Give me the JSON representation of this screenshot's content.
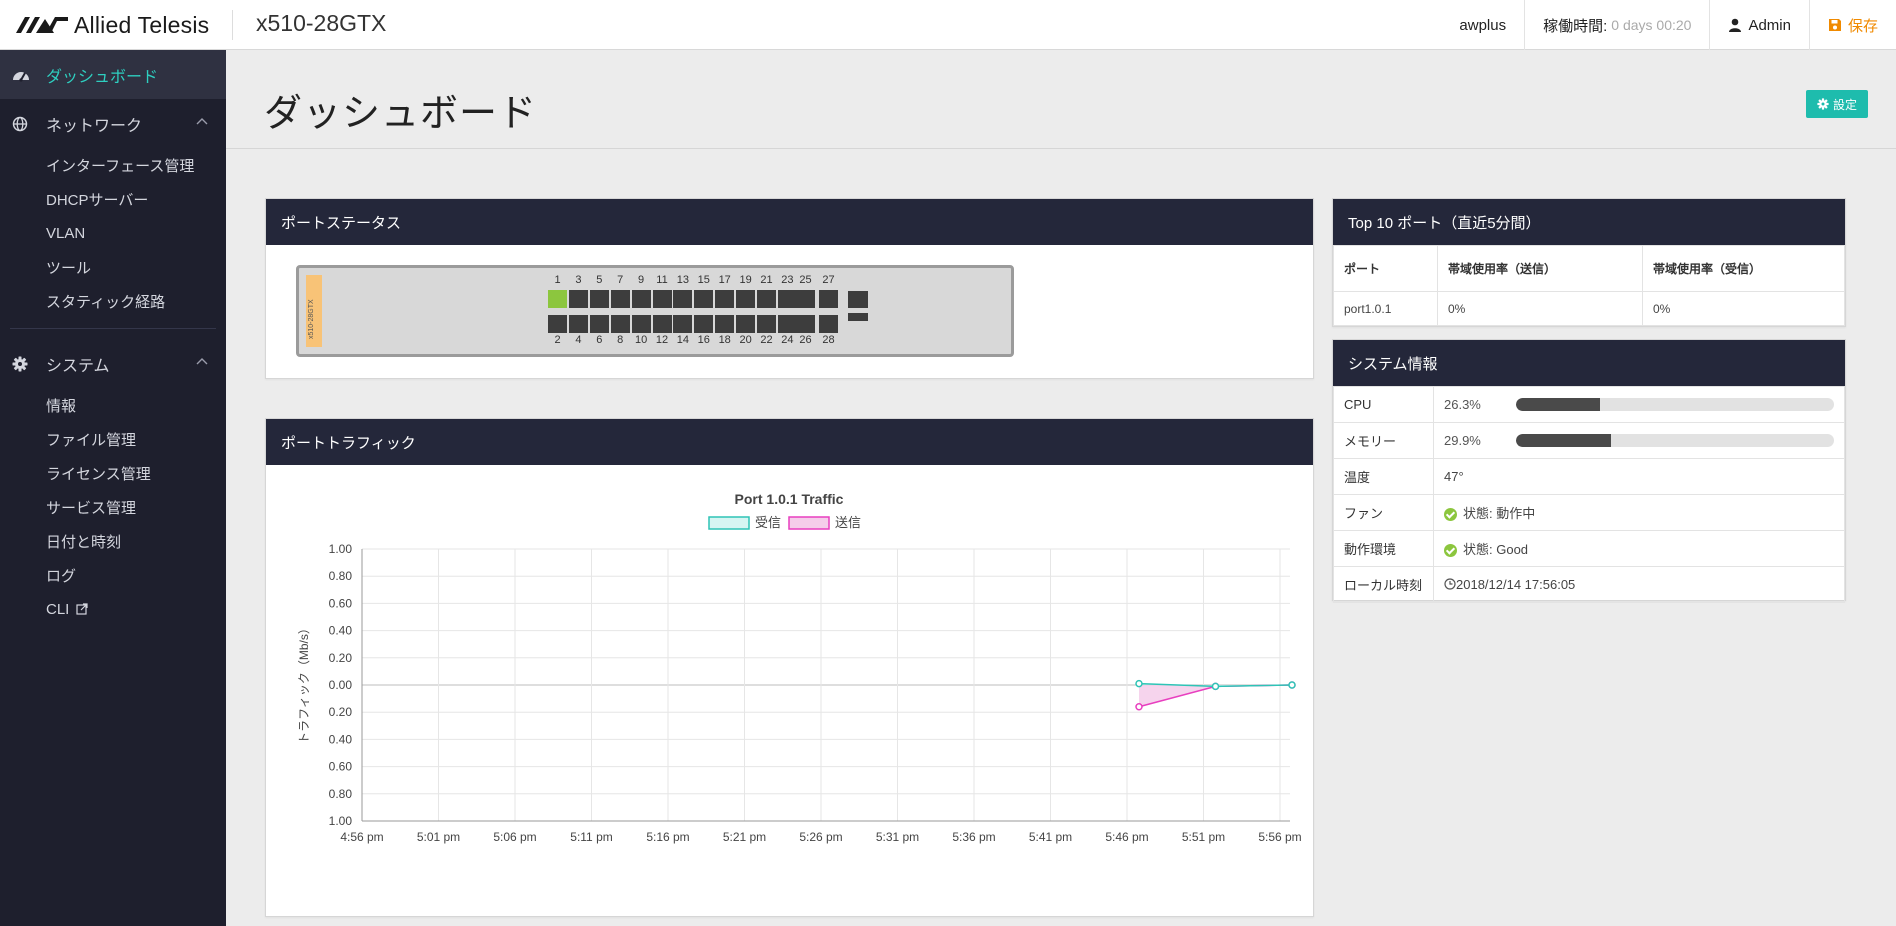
{
  "header": {
    "brand": "Allied Telesis",
    "device": "x510-28GTX",
    "hostname": "awplus",
    "uptime_label": "稼働時間:",
    "uptime_value": "0 days 00:20",
    "user": "Admin",
    "save_label": "保存",
    "accent_color": "#f08a00"
  },
  "sidebar": {
    "dashboard": "ダッシュボード",
    "network": {
      "label": "ネットワーク",
      "items": [
        "インターフェース管理",
        "DHCPサーバー",
        "VLAN",
        "ツール",
        "スタティック経路"
      ]
    },
    "system": {
      "label": "システム",
      "items": [
        "情報",
        "ファイル管理",
        "ライセンス管理",
        "サービス管理",
        "日付と時刻",
        "ログ",
        "CLI"
      ]
    },
    "active_color": "#2ecfc0"
  },
  "page": {
    "title": "ダッシュボード",
    "settings_label": "設定"
  },
  "port_status": {
    "title": "ポートステータス",
    "switch_label": "x510-28GTX",
    "top_numbers": [
      "1",
      "3",
      "5",
      "7",
      "9",
      "11",
      "13",
      "15",
      "17",
      "19",
      "21",
      "23",
      "25",
      "27"
    ],
    "bottom_numbers": [
      "2",
      "4",
      "6",
      "8",
      "10",
      "12",
      "14",
      "16",
      "18",
      "20",
      "22",
      "24",
      "26",
      "28"
    ],
    "link_up_ports": [
      "1"
    ]
  },
  "top10": {
    "title": "Top 10 ポート（直近5分間）",
    "columns": [
      "ポート",
      "帯域使用率（送信）",
      "帯域使用率（受信）"
    ],
    "rows": [
      [
        "port1.0.1",
        "0%",
        "0%"
      ]
    ]
  },
  "system_info": {
    "title": "システム情報",
    "cpu_label": "CPU",
    "cpu_value": "26.3%",
    "cpu_fraction": 0.263,
    "memory_label": "メモリー",
    "memory_value": "29.9%",
    "memory_fraction": 0.299,
    "temp_label": "温度",
    "temp_value": "47°",
    "fan_label": "ファン",
    "fan_value": "状態: 動作中",
    "env_label": "動作環境",
    "env_value": "状態: Good",
    "time_label": "ローカル時刻",
    "time_value": "2018/12/14 17:56:05"
  },
  "traffic": {
    "title": "ポートトラフィック",
    "chart_data": {
      "type": "area",
      "title": "Port 1.0.1 Traffic",
      "ylabel": "トラフィック（Mb/s）",
      "xlabel": "",
      "categories": [
        "4:56 pm",
        "5:01 pm",
        "5:06 pm",
        "5:11 pm",
        "5:16 pm",
        "5:21 pm",
        "5:26 pm",
        "5:31 pm",
        "5:36 pm",
        "5:41 pm",
        "5:46 pm",
        "5:51 pm",
        "5:56 pm"
      ],
      "y_tick_labels": [
        "1.00",
        "0.80",
        "0.60",
        "0.40",
        "0.20",
        "0.00",
        "0.20",
        "0.40",
        "0.60",
        "0.80",
        "1.00"
      ],
      "ylim": [
        -1,
        1
      ],
      "grid": true,
      "legend_position": "top-center",
      "series": [
        {
          "name": "受信",
          "color": "#2ec4b6",
          "fill": "#d6f5f2",
          "x": [
            "5:46 pm",
            "5:51 pm",
            "5:56 pm"
          ],
          "values": [
            0.01,
            -0.01,
            0.0
          ]
        },
        {
          "name": "送信",
          "color": "#e83fbf",
          "fill": "#f5cdea",
          "x": [
            "5:46 pm",
            "5:51 pm",
            "5:56 pm"
          ],
          "values": [
            -0.16,
            -0.01,
            0.0
          ]
        }
      ]
    }
  }
}
